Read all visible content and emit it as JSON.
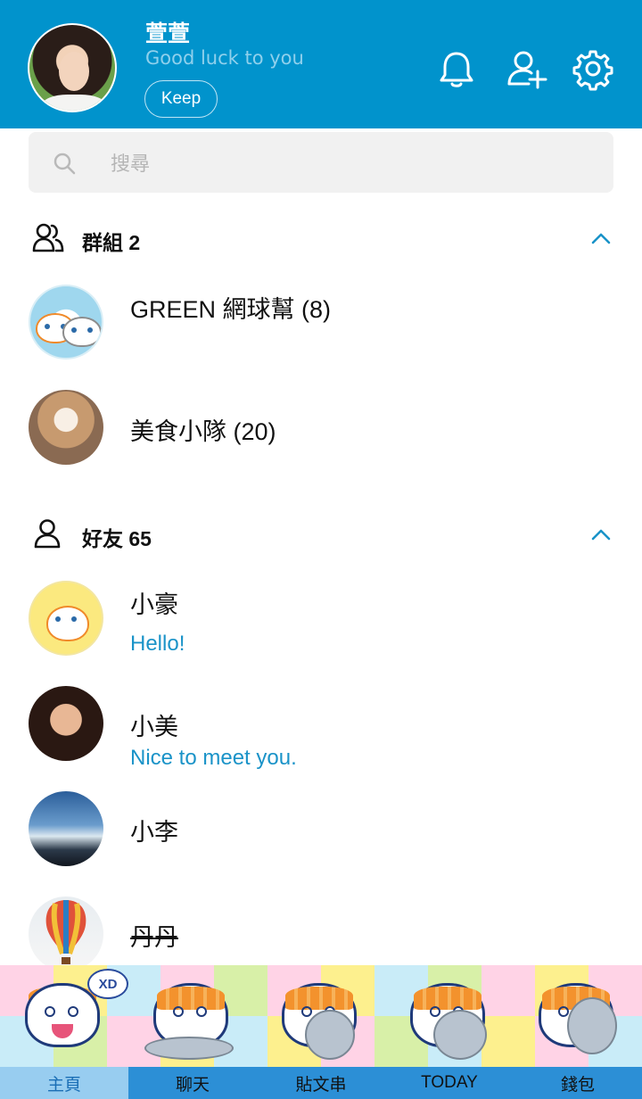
{
  "profile": {
    "name": "萱萱",
    "status": "Good luck to you",
    "keep_label": "Keep"
  },
  "header_icons": [
    "bell-icon",
    "add-friend-icon",
    "gear-icon"
  ],
  "search": {
    "placeholder": "搜尋"
  },
  "groups": {
    "title": "群組 2",
    "items": [
      {
        "name": "GREEN 網球幫 (8)",
        "avatar": "sticker-lanlan"
      },
      {
        "name": "美食小隊 (20)",
        "avatar": "cat-photo"
      }
    ]
  },
  "friends": {
    "title": "好友 65",
    "items": [
      {
        "name": "小豪",
        "message": "Hello!",
        "avatar": "sticker-im-awesome"
      },
      {
        "name": "小美",
        "message": "Nice to meet you.",
        "avatar": "woman-photo"
      },
      {
        "name": "小李",
        "message": "",
        "avatar": "sky-photo"
      },
      {
        "name": "丹丹",
        "message": "",
        "avatar": "balloon-photo"
      }
    ]
  },
  "banner": {
    "bubble_text": "XD"
  },
  "tabs": [
    {
      "label": "主頁",
      "active": true
    },
    {
      "label": "聊天",
      "active": false
    },
    {
      "label": "貼文串",
      "active": false
    },
    {
      "label": "TODAY",
      "active": false
    },
    {
      "label": "錢包",
      "active": false
    }
  ],
  "colors": {
    "header_bg": "#0193cc",
    "accent_text": "#1a93c8",
    "tabbar_bg": "#2c8fd6",
    "tab_active_bg": "#98cdf0"
  }
}
